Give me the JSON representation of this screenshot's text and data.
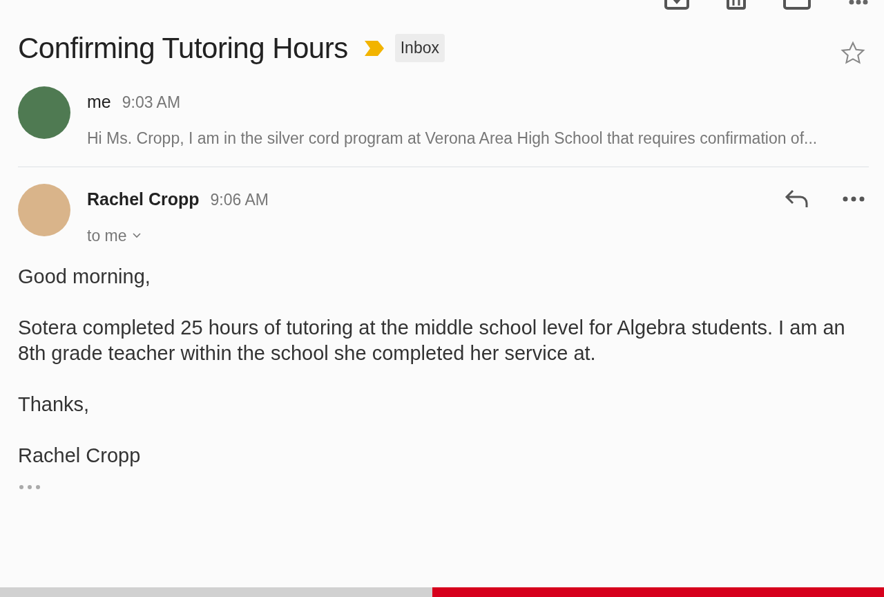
{
  "subject": {
    "title": "Confirming Tutoring Hours",
    "label": "Inbox",
    "important": true,
    "starred": false
  },
  "messages": [
    {
      "kind": "collapsed",
      "sender": "me",
      "time": "9:03 AM",
      "snippet": "Hi Ms. Cropp, I am in the silver cord program at Verona Area High School that requires confirmation of..."
    },
    {
      "kind": "expanded",
      "sender": "Rachel Cropp",
      "time": "9:06 AM",
      "recipient": "to me",
      "body": [
        "Good morning,",
        "Sotera completed 25 hours of tutoring at the middle school level for Algebra students. I am an 8th grade teacher within the school she completed her service at.",
        "Thanks,",
        "Rachel Cropp"
      ]
    }
  ]
}
